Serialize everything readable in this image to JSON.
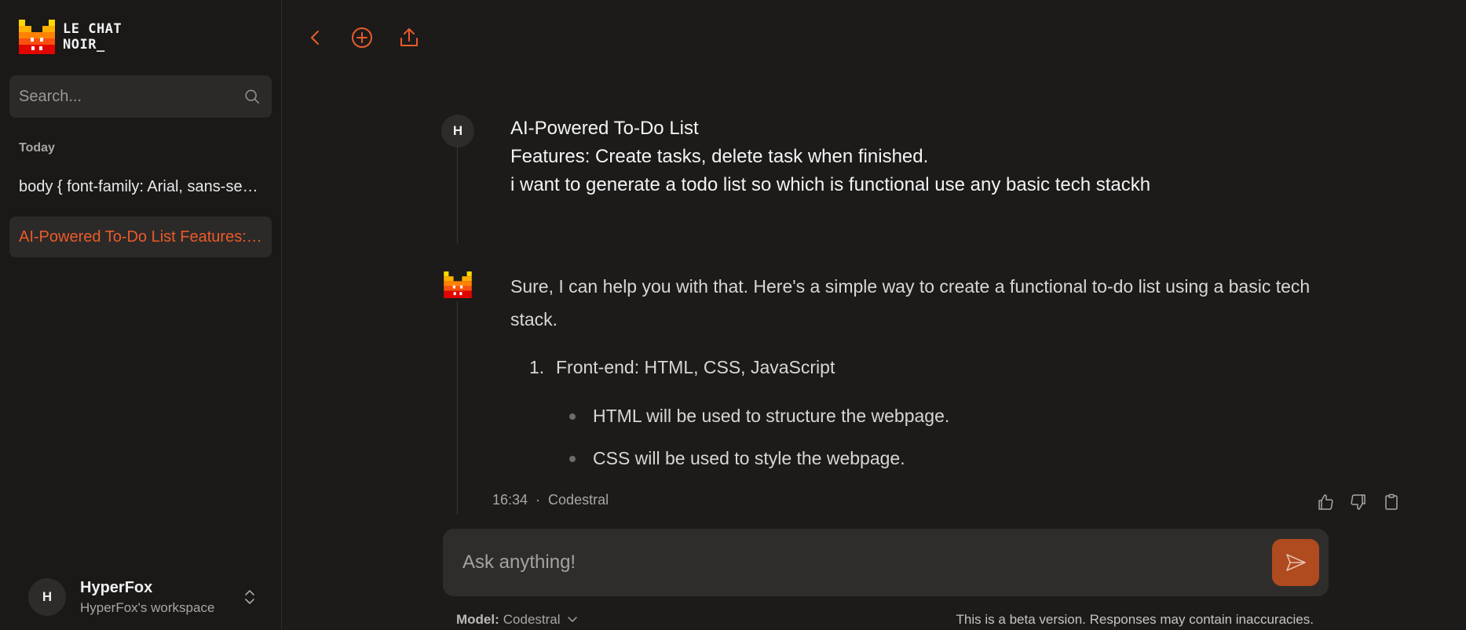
{
  "brand": {
    "line1": "LE CHAT",
    "line2": "NOIR_"
  },
  "search": {
    "placeholder": "Search..."
  },
  "sidebar": {
    "section_label": "Today",
    "items": [
      {
        "label": "body { font-family: Arial, sans-serif; }"
      },
      {
        "label": "AI-Powered To-Do List Features: Create tasks"
      }
    ]
  },
  "user": {
    "avatar_initial": "H",
    "name": "HyperFox",
    "workspace": "HyperFox's workspace"
  },
  "thread": {
    "user_message": {
      "avatar_initial": "H",
      "lines": [
        "AI-Powered To-Do List",
        "Features: Create tasks, delete task when finished.",
        "i want to generate a todo list so which is functional use any basic tech stackh"
      ]
    },
    "ai_message": {
      "intro": "Sure, I can help you with that. Here's a simple way to create a functional to-do list using a basic tech stack.",
      "list": [
        {
          "num": "1.",
          "text": "Front-end: HTML, CSS, JavaScript"
        }
      ],
      "bullets": [
        "HTML will be used to structure the webpage.",
        "CSS will be used to style the webpage."
      ],
      "time": "16:34",
      "separator": "·",
      "model": "Codestral"
    }
  },
  "composer": {
    "placeholder": "Ask anything!"
  },
  "footer": {
    "model_label": "Model:",
    "model_value": "Codestral",
    "disclaimer": "This is a beta version. Responses may contain inaccuracies."
  },
  "colors": {
    "accent": "#ea5b2a",
    "send_bg": "#b04a1f",
    "bg": "#1c1b1a",
    "sidebar_bg": "#1a1918"
  }
}
